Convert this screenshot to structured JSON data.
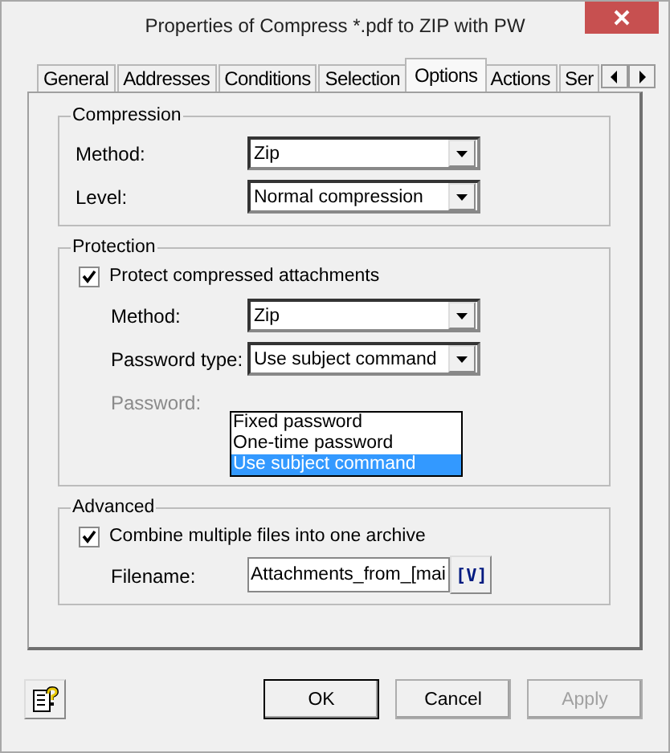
{
  "window": {
    "title": "Properties of Compress *.pdf to ZIP with PW"
  },
  "tabs": [
    {
      "label": "General",
      "selected": false
    },
    {
      "label": "Addresses",
      "selected": false
    },
    {
      "label": "Conditions",
      "selected": false
    },
    {
      "label": "Selection",
      "selected": false
    },
    {
      "label": "Options",
      "selected": true
    },
    {
      "label": "Actions",
      "selected": false
    },
    {
      "label": "Ser",
      "selected": false
    }
  ],
  "compression": {
    "legend": "Compression",
    "fields": [
      {
        "label": "Method:",
        "value": "Zip"
      },
      {
        "label": "Level:",
        "value": "Normal compression"
      }
    ]
  },
  "protection": {
    "legend": "Protection",
    "checkbox": {
      "label": "Protect compressed attachments",
      "checked": true
    },
    "fields": [
      {
        "label": "Method:",
        "value": "Zip",
        "disabled": false
      },
      {
        "label": "Password type:",
        "value": "Use subject command",
        "disabled": false
      },
      {
        "label": "Password:",
        "disabled": true
      }
    ],
    "open_list": {
      "options": [
        {
          "label": "Fixed password",
          "selected": false
        },
        {
          "label": "One-time password",
          "selected": false
        },
        {
          "label": "Use subject command",
          "selected": true
        }
      ]
    }
  },
  "advanced": {
    "legend": "Advanced",
    "checkbox": {
      "label": "Combine multiple files into one archive",
      "checked": true
    },
    "filename": {
      "label": "Filename:",
      "value": "Attachments_from_[mai",
      "variable_button": "[V]"
    }
  },
  "buttons": [
    {
      "label": "OK",
      "disabled": false,
      "default": true
    },
    {
      "label": "Cancel",
      "disabled": false,
      "default": false
    },
    {
      "label": "Apply",
      "disabled": true,
      "default": false
    }
  ]
}
